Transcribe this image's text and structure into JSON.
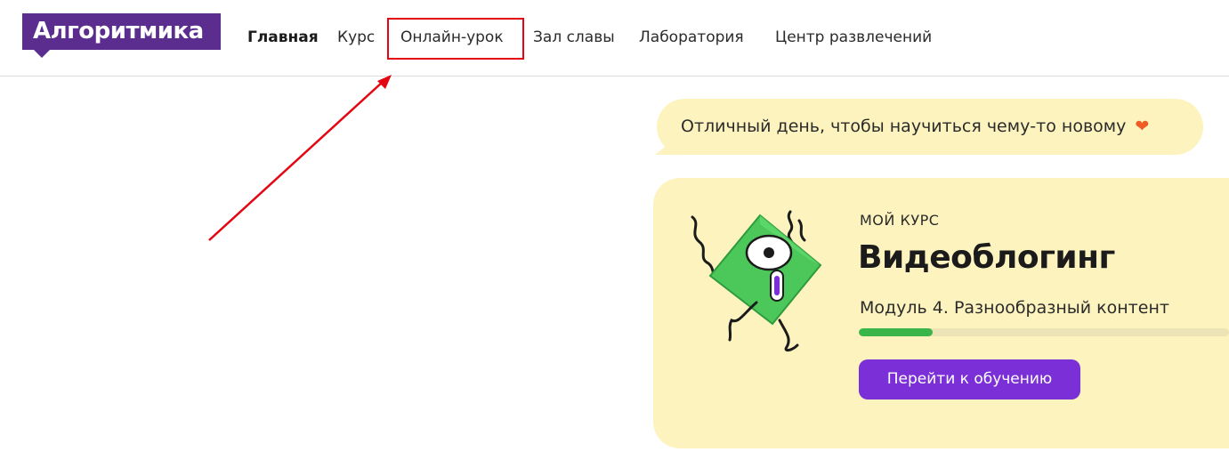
{
  "header": {
    "logo_text": "Алгоритмика",
    "nav": [
      {
        "label": "Главная",
        "active": true
      },
      {
        "label": "Курс",
        "active": false
      },
      {
        "label": "Онлайн-урок",
        "active": false
      },
      {
        "label": "Зал славы",
        "active": false
      },
      {
        "label": "Лаборатория",
        "active": false
      },
      {
        "label": "Центр развлечений",
        "active": false
      }
    ]
  },
  "greeting": {
    "text": "Отличный день, чтобы научиться чему-то новому",
    "emoji": "❤"
  },
  "course_card": {
    "kicker": "МОЙ КУРС",
    "title": "Видеоблогинг",
    "module": "Модуль 4. Разнообразный контент",
    "progress": 0.2,
    "button_label": "Перейти к обучению"
  },
  "colors": {
    "brand_purple": "#5b2d8e",
    "button_purple": "#7b2fd6",
    "card_yellow": "#fdf3bf",
    "progress_green": "#3ab54a",
    "annotation_red": "#e30613",
    "heart_orange": "#f15a24"
  },
  "icons": {
    "mascot": "green-diamond-cyclops-mascot",
    "heart": "heart-icon"
  }
}
